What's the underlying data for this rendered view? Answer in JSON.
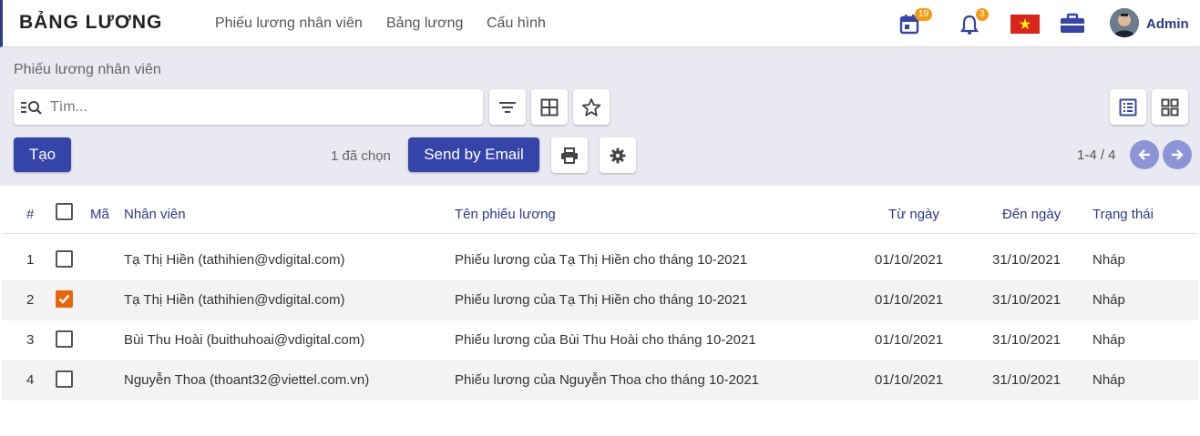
{
  "header": {
    "app_title": "BẢNG LƯƠNG",
    "nav": [
      {
        "label": "Phiếu lương nhân viên"
      },
      {
        "label": "Bảng lương"
      },
      {
        "label": "Cấu hình"
      }
    ],
    "calendar_badge": "19",
    "notification_badge": "3",
    "user_name": "Admin",
    "icons": [
      "calendar-icon",
      "bell-icon",
      "vietnam-flag-icon",
      "briefcase-icon"
    ]
  },
  "control": {
    "breadcrumb": "Phiếu lương nhân viên",
    "search_placeholder": "Tìm...",
    "create_label": "Tạo",
    "selected_text": "1 đã chọn",
    "send_email_label": "Send by Email",
    "pager_text": "1-4 / 4"
  },
  "table": {
    "headers": {
      "index": "#",
      "code": "Mã",
      "employee": "Nhân viên",
      "payslip_name": "Tên phiếu lương",
      "from_date": "Từ ngày",
      "to_date": "Đến ngày",
      "status": "Trạng thái"
    },
    "rows": [
      {
        "index": "1",
        "checked": false,
        "code": "",
        "employee": "Tạ Thị Hiền (tathihien@vdigital.com)",
        "payslip_name": "Phiếu lương của Tạ Thị Hiền cho tháng 10-2021",
        "from_date": "01/10/2021",
        "to_date": "31/10/2021",
        "status": "Nháp"
      },
      {
        "index": "2",
        "checked": true,
        "code": "",
        "employee": "Tạ Thị Hiền (tathihien@vdigital.com)",
        "payslip_name": "Phiếu lương của Tạ Thị Hiền cho tháng 10-2021",
        "from_date": "01/10/2021",
        "to_date": "31/10/2021",
        "status": "Nháp"
      },
      {
        "index": "3",
        "checked": false,
        "code": "",
        "employee": "Bùi Thu Hoài (buithuhoai@vdigital.com)",
        "payslip_name": "Phiếu lương của Bùi Thu Hoài cho tháng 10-2021",
        "from_date": "01/10/2021",
        "to_date": "31/10/2021",
        "status": "Nháp"
      },
      {
        "index": "4",
        "checked": false,
        "code": "",
        "employee": "Nguyễn Thoa (thoant32@viettel.com.vn)",
        "payslip_name": "Phiếu lương của Nguyễn Thoa cho tháng 10-2021",
        "from_date": "01/10/2021",
        "to_date": "31/10/2021",
        "status": "Nháp"
      }
    ]
  },
  "colors": {
    "primary": "#3444a8",
    "header_text": "#2c3a8c",
    "checkbox_checked": "#e8650a",
    "badge": "#f39c12",
    "control_bg": "#e8e9f1"
  }
}
